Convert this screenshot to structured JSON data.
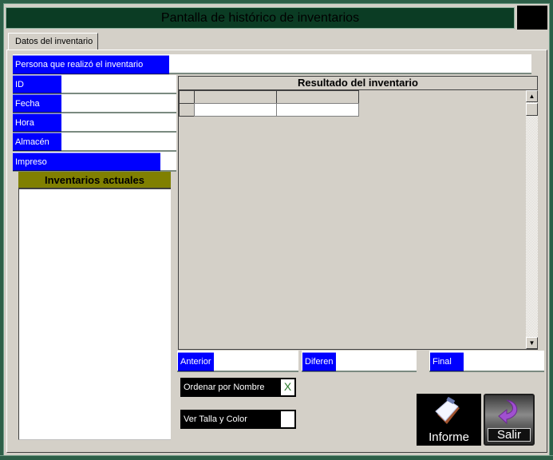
{
  "window": {
    "title": "Pantalla de histórico de inventarios"
  },
  "tabs": [
    {
      "label": "Datos del inventario",
      "active": true
    }
  ],
  "fields": {
    "persona": {
      "label": "Persona que realizó el inventario",
      "value": ""
    },
    "id": {
      "label": "ID",
      "value": ""
    },
    "fecha": {
      "label": "Fecha",
      "value": ""
    },
    "hora": {
      "label": "Hora",
      "value": ""
    },
    "almacen": {
      "label": "Almacén",
      "value": ""
    },
    "impreso": {
      "label": "Impreso",
      "value": ""
    }
  },
  "inventarios_actuales": {
    "title": "Inventarios actuales",
    "items": []
  },
  "resultado": {
    "title": "Resultado del inventario",
    "columns": [
      "",
      ""
    ],
    "rows": [
      [
        "",
        ""
      ]
    ]
  },
  "totals": {
    "anterior": {
      "label": "Anterior",
      "value": ""
    },
    "diferencia": {
      "label": "Diferen",
      "value": ""
    },
    "final": {
      "label": "Final",
      "value": ""
    }
  },
  "options": {
    "ordenar_por_nombre": {
      "label": "Ordenar por Nombre",
      "checked": true,
      "mark": "X"
    },
    "ver_talla_color": {
      "label": "Ver Talla y Color",
      "checked": false,
      "mark": ""
    }
  },
  "buttons": {
    "informe": "Informe",
    "salir": "Salir"
  },
  "colors": {
    "label_bg": "#0000ff",
    "title_bg": "#0b3c24",
    "list_header_bg": "#808000",
    "window_bg": "#d4d0c8"
  }
}
